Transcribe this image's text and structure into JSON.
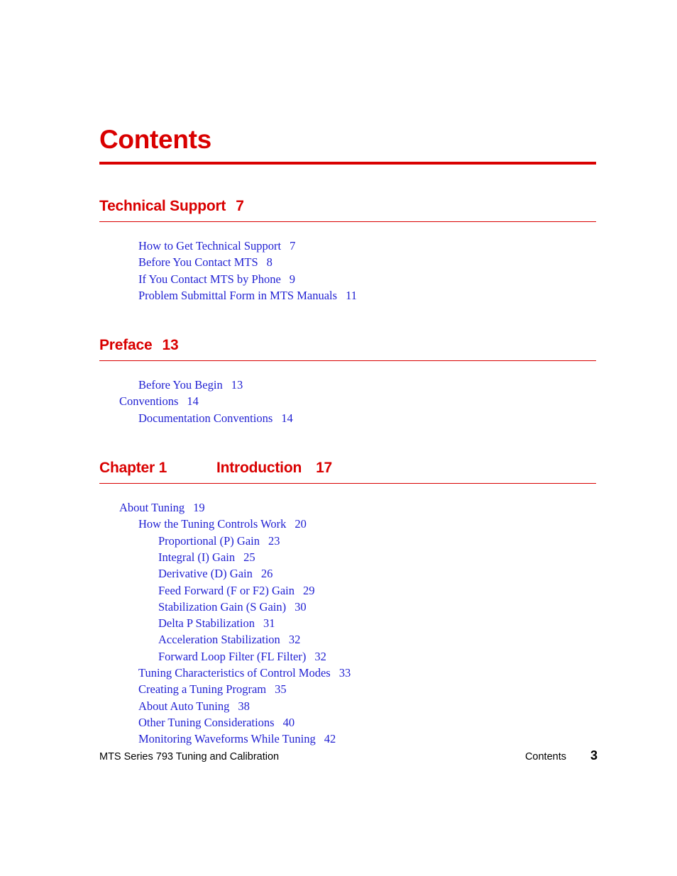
{
  "page": {
    "title": "Contents",
    "accent_red": "#d90000",
    "entry_blue": "#1f1fd2"
  },
  "sections": [
    {
      "kind": "part",
      "label": "Technical Support",
      "page": "7",
      "entries": [
        {
          "level": 2,
          "label": "How to Get Technical Support",
          "page": "7"
        },
        {
          "level": 2,
          "label": "Before You Contact MTS",
          "page": "8"
        },
        {
          "level": 2,
          "label": "If You Contact MTS by Phone",
          "page": "9"
        },
        {
          "level": 2,
          "label": "Problem Submittal Form in MTS Manuals",
          "page": "11"
        }
      ]
    },
    {
      "kind": "part",
      "label": "Preface",
      "page": "13",
      "entries": [
        {
          "level": 2,
          "label": "Before You Begin",
          "page": "13"
        },
        {
          "level": 1,
          "label": "Conventions",
          "page": "14"
        },
        {
          "level": 2,
          "label": "Documentation Conventions",
          "page": "14"
        }
      ]
    },
    {
      "kind": "chapter",
      "label": "Chapter 1",
      "title": "Introduction",
      "page": "17",
      "entries": [
        {
          "level": 1,
          "label": "About Tuning",
          "page": "19"
        },
        {
          "level": 2,
          "label": "How the Tuning Controls Work",
          "page": "20"
        },
        {
          "level": 3,
          "label": "Proportional (P) Gain",
          "page": "23"
        },
        {
          "level": 3,
          "label": "Integral (I) Gain",
          "page": "25"
        },
        {
          "level": 3,
          "label": "Derivative (D) Gain",
          "page": "26"
        },
        {
          "level": 3,
          "label": "Feed Forward (F or F2) Gain",
          "page": "29"
        },
        {
          "level": 3,
          "label": "Stabilization Gain (S Gain)",
          "page": "30"
        },
        {
          "level": 3,
          "label": "Delta P Stabilization",
          "page": "31"
        },
        {
          "level": 3,
          "label": "Acceleration Stabilization",
          "page": "32"
        },
        {
          "level": 3,
          "label": "Forward Loop Filter (FL Filter)",
          "page": "32"
        },
        {
          "level": 2,
          "label": "Tuning Characteristics of Control Modes",
          "page": "33"
        },
        {
          "level": 2,
          "label": "Creating a Tuning Program",
          "page": "35"
        },
        {
          "level": 2,
          "label": "About Auto Tuning",
          "page": "38"
        },
        {
          "level": 2,
          "label": "Other Tuning Considerations",
          "page": "40"
        },
        {
          "level": 2,
          "label": "Monitoring Waveforms While Tuning",
          "page": "42"
        }
      ]
    }
  ],
  "footer": {
    "document_title": "MTS Series 793 Tuning and Calibration",
    "section_label": "Contents",
    "page_number": "3"
  }
}
